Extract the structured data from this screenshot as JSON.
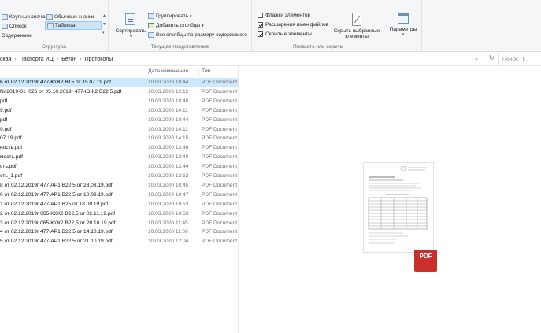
{
  "ribbon": {
    "layout": {
      "items": [
        "Крупные значки",
        "Обычные значки",
        "Список",
        "Таблица",
        "Содержимое"
      ],
      "selected": "Таблица",
      "label": "Структура"
    },
    "current_view": {
      "sort_label": "Сортировать",
      "group_label": "Группировать",
      "add_columns_label": "Добавить столбцы",
      "fit_columns_label": "Все столбцы по размеру содержимого",
      "label": "Текущее представление"
    },
    "show_hide": {
      "checkbox_item_label": "Флажки элементов",
      "checkbox_item_checked": false,
      "extensions_label": "Расширения имен файлов",
      "extensions_checked": true,
      "hidden_label": "Скрытые элементы",
      "hidden_checked": true,
      "hide_selected_label_1": "Скрыть выбранные",
      "hide_selected_label_2": "элементы",
      "label": "Показать или скрыть"
    },
    "options_label": "Параметры"
  },
  "address": {
    "crumbs": [
      "ская",
      "Паспорта ИЦ",
      "Бетон",
      "Протоколы"
    ],
    "search_placeholder": "Поиск: П..."
  },
  "columns": {
    "date": "Дата изменения",
    "type": "Тип"
  },
  "files": [
    {
      "name": "6 от 02.12.2019г 477-ЮЖ2 В15 от 15.07.19.pdf",
      "date": "10.03.2020 10:44",
      "type": "PDF Document",
      "selected": true
    },
    {
      "name": "N#2019-01_026 от 05.10.2019г 477-ЮЖ2 В22,5.pdf",
      "date": "10.03.2020 12:12",
      "type": "PDF Document",
      "selected": false
    },
    {
      "name": "pdf",
      "date": "10.03.2020 10:40",
      "type": "PDF Document",
      "selected": false
    },
    {
      "name": "9.pdf",
      "date": "10.03.2020 14:11",
      "type": "PDF Document",
      "selected": false
    },
    {
      "name": "pdf",
      "date": "10.03.2020 10:44",
      "type": "PDF Document",
      "selected": false
    },
    {
      "name": "9.pdf",
      "date": "10.03.2020 14:11",
      "type": "PDF Document",
      "selected": false
    },
    {
      "name": "07.19.pdf",
      "date": "10.03.2020 14:15",
      "type": "PDF Document",
      "selected": false
    },
    {
      "name": "ность.pdf",
      "date": "10.03.2020 13:46",
      "type": "PDF Document",
      "selected": false
    },
    {
      "name": "мость.pdf",
      "date": "10.03.2020 13:40",
      "type": "PDF Document",
      "selected": false
    },
    {
      "name": "сть.pdf",
      "date": "10.03.2020 13:44",
      "type": "PDF Document",
      "selected": false
    },
    {
      "name": "сть_1.pdf",
      "date": "10.03.2020 13:52",
      "type": "PDF Document",
      "selected": false
    },
    {
      "name": "8 от 02.12.2019г 477-АР1 В22,5 от 28.08.19.pdf",
      "date": "10.03.2020 10:45",
      "type": "PDF Document",
      "selected": false
    },
    {
      "name": "0 от 02.12.2019г 477-АР1 В22,5 от 10.09.19.pdf",
      "date": "10.03.2020 10:47",
      "type": "PDF Document",
      "selected": false
    },
    {
      "name": "1 от 02.12.2019г 477-АР1 В25 от 18.09.19.pdf",
      "date": "10.03.2020 10:53",
      "type": "PDF Document",
      "selected": false
    },
    {
      "name": "2 от 02.12.2019г 065-ЮЖ2 В22,5 от 02.11.19.pdf",
      "date": "10.03.2020 10:53",
      "type": "PDF Document",
      "selected": false
    },
    {
      "name": "3 от 02.12.2019г 065-ЮЖ2 В22,5 от 28.10.19.pdf",
      "date": "10.03.2020 11:45",
      "type": "PDF Document",
      "selected": false
    },
    {
      "name": "4 от 02.12.2019г 477-АР1 В22,5 от 14.10.19.pdf",
      "date": "10.03.2020 11:50",
      "type": "PDF Document",
      "selected": false
    },
    {
      "name": "5 от 02.12.2019г 477-АР1 В22,5 от 21.10.19.pdf",
      "date": "10.03.2020 12:04",
      "type": "PDF Document",
      "selected": false
    }
  ],
  "preview": {
    "badge_text": "PDF",
    "badge_color": "#c9302c"
  },
  "colors": {
    "selection": "#cce8ff",
    "ribbon_bg": "#f5f6f7",
    "accent": "#4c607a"
  }
}
